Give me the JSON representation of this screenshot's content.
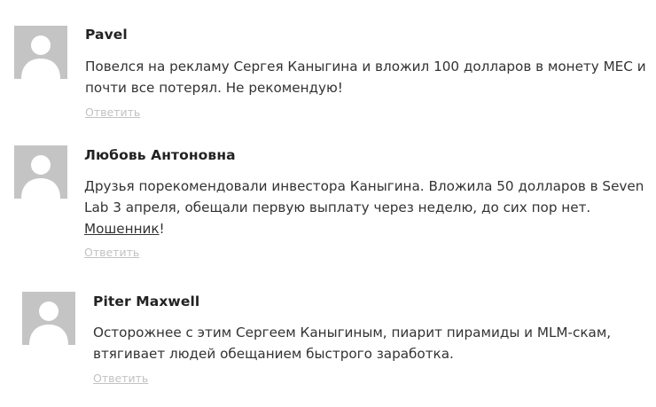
{
  "comments": [
    {
      "author": "Pavel",
      "lines": [
        "Повелся на рекламу Сергея Каныгина и вложил 100 долларов в монету MEC и",
        "почти все потерял. Не рекомендую!"
      ],
      "reply_label": "Ответить"
    },
    {
      "author": "Любовь Антоновна",
      "lines": [
        "Друзья порекомендовали инвестора Каныгина. Вложила 50 долларов в Seven",
        "Lab 3 апреля, обещали первую выплату через неделю, до сих пор нет."
      ],
      "link_text": "Мошенник",
      "link_suffix": "!",
      "reply_label": "Ответить"
    },
    {
      "author": "Piter Maxwell",
      "lines": [
        "Осторожнее с этим Сергеем Каныгиным, пиарит пирамиды и MLM-скам,",
        "втягивает людей обещанием быстрого заработка."
      ],
      "reply_label": "Ответить"
    }
  ],
  "icons": {
    "avatar": "default-avatar-icon"
  },
  "colors": {
    "avatar_bg": "#c4c4c4",
    "avatar_fg": "#ffffff",
    "text": "#333333",
    "author": "#222222",
    "reply": "#c2c2c2"
  }
}
